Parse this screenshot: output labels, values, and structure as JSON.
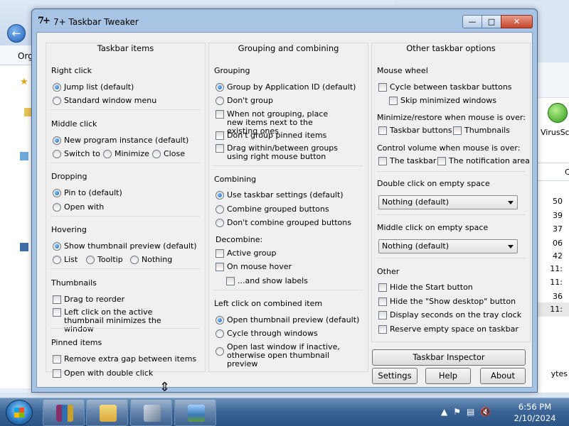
{
  "background": {
    "explorer": {
      "org_label": "Orga"
    },
    "right_window": {
      "vendor_label": "VirusSca",
      "column_header": "C",
      "time_values": [
        "50",
        "39",
        "37",
        "06",
        "42",
        "11:",
        "11:",
        "36",
        "11:"
      ],
      "bytes_label": "ytes"
    }
  },
  "window": {
    "title": "7+ Taskbar Tweaker",
    "icon_glyph": "7+",
    "caption": {
      "minimize": "—",
      "maximize": "□",
      "close": "✕"
    }
  },
  "taskbar_items": {
    "header": "Taskbar items",
    "right_click": {
      "label": "Right click",
      "options": [
        "Jump list (default)",
        "Standard window menu"
      ],
      "selected": 0
    },
    "middle_click": {
      "label": "Middle click",
      "options": [
        "New program instance (default)",
        "Switch to",
        "Minimize",
        "Close"
      ],
      "selected": 0
    },
    "dropping": {
      "label": "Dropping",
      "options": [
        "Pin to (default)",
        "Open with"
      ],
      "selected": 0
    },
    "hovering": {
      "label": "Hovering",
      "options": [
        "Show thumbnail preview (default)",
        "List",
        "Tooltip",
        "Nothing"
      ],
      "selected": 0
    },
    "thumbnails": {
      "label": "Thumbnails",
      "options": [
        "Drag to reorder",
        "Left click on the active thumbnail minimizes the window"
      ]
    },
    "pinned_items": {
      "label": "Pinned items",
      "options": [
        "Remove extra gap between items",
        "Open with double click"
      ]
    }
  },
  "grouping_combining": {
    "header": "Grouping and combining",
    "grouping": {
      "label": "Grouping",
      "radios": [
        "Group by Application ID (default)",
        "Don't group"
      ],
      "selected": 0,
      "checks": [
        "When not grouping, place new items next to the existing ones",
        "Don't group pinned items",
        "Drag within/between groups using right mouse button"
      ]
    },
    "combining": {
      "label": "Combining",
      "options": [
        "Use taskbar settings (default)",
        "Combine grouped buttons",
        "Don't combine grouped buttons"
      ],
      "selected": 0
    },
    "decombine": {
      "label": "Decombine:",
      "options": [
        "Active group",
        "On mouse hover",
        "...and show labels"
      ]
    },
    "left_click_combined": {
      "label": "Left click on combined item",
      "options": [
        "Open thumbnail preview (default)",
        "Cycle through windows",
        "Open last window if inactive, otherwise open thumbnail preview"
      ],
      "selected": 0
    }
  },
  "other_options": {
    "header": "Other taskbar options",
    "mouse_wheel": {
      "label": "Mouse wheel",
      "options": [
        "Cycle between taskbar buttons",
        "Skip minimized windows"
      ]
    },
    "minimize_restore": {
      "label": "Minimize/restore when mouse is over:",
      "options": [
        "Taskbar buttons",
        "Thumbnails"
      ]
    },
    "control_volume": {
      "label": "Control volume when mouse is over:",
      "options": [
        "The taskbar",
        "The notification area"
      ]
    },
    "double_click_empty": {
      "label": "Double click on empty space",
      "value": "Nothing (default)"
    },
    "middle_click_empty": {
      "label": "Middle click on empty space",
      "value": "Nothing (default)"
    },
    "other": {
      "label": "Other",
      "options": [
        "Hide the Start button",
        "Hide the \"Show desktop\" button",
        "Display seconds on the tray clock",
        "Reserve empty space on taskbar"
      ]
    }
  },
  "buttons": {
    "inspector": "Taskbar Inspector",
    "settings": "Settings",
    "help": "Help",
    "about": "About"
  },
  "taskbar": {
    "time": "6:56 PM",
    "date": "2/10/2024",
    "apps": [
      {
        "name": "winrar",
        "color": "#8a2e6a"
      },
      {
        "name": "file-explorer",
        "color": "#e8c25a"
      },
      {
        "name": "taskbar-tweaker",
        "color": "#7d8fa5"
      },
      {
        "name": "photos",
        "color": "#4d86c4"
      }
    ],
    "tray_icons": [
      "show-hidden-icons-arrow",
      "action-center-flag",
      "network-icon",
      "volume-muted-icon"
    ]
  },
  "cursor": {
    "glyph": "⇕"
  }
}
